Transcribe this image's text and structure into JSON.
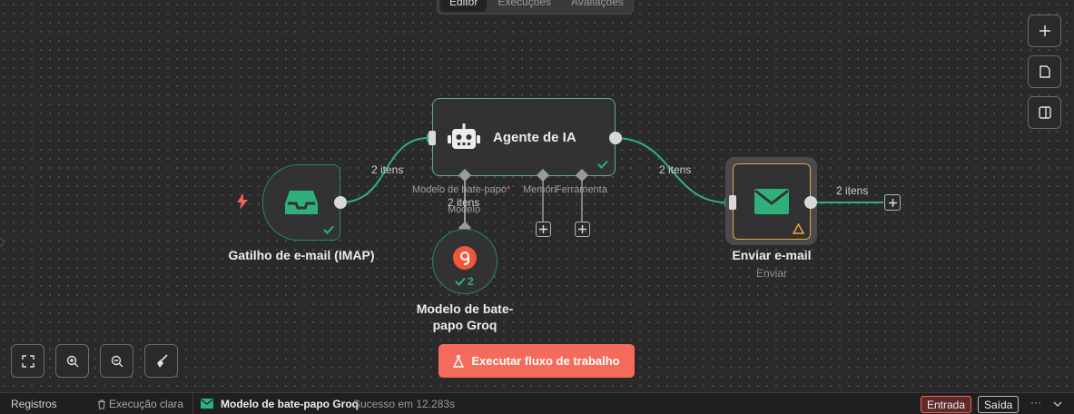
{
  "tabs": [
    "Editor",
    "Execuções",
    "Avaliações"
  ],
  "nodes": {
    "trigger": {
      "title": "Gatilho de e-mail (IMAP)"
    },
    "agent": {
      "title": "Agente de IA",
      "port_chat_model": "Modelo de bate-papo",
      "port_chat_model_required": "*",
      "port_memory": "Memória",
      "port_tool": "Ferramenta"
    },
    "model": {
      "title_line1": "Modelo de bate-",
      "title_line2": "papo Groq",
      "badge_count": "2",
      "port_label": "Modelo"
    },
    "send": {
      "title": "Enviar e-mail",
      "subtitle": "Enviar"
    }
  },
  "edges": {
    "trigger_to_agent": "2 itens",
    "model_to_agent": "2 itens",
    "agent_to_send": "2 itens",
    "send_out": "2 itens"
  },
  "execute_button": {
    "label": "Executar fluxo de trabalho"
  },
  "bottom": {
    "logs": "Registros",
    "clear": "Execução clara",
    "node_name": "Modelo de bate-papo Groq",
    "status": "Sucesso em 12.283s",
    "input": "Entrada",
    "output": "Saída",
    "more": "···"
  },
  "colors": {
    "accent_green": "#1f8a63",
    "success_green": "#2fb07a",
    "execute_red": "#f46b5b",
    "warning_orange": "#e8a33d"
  }
}
